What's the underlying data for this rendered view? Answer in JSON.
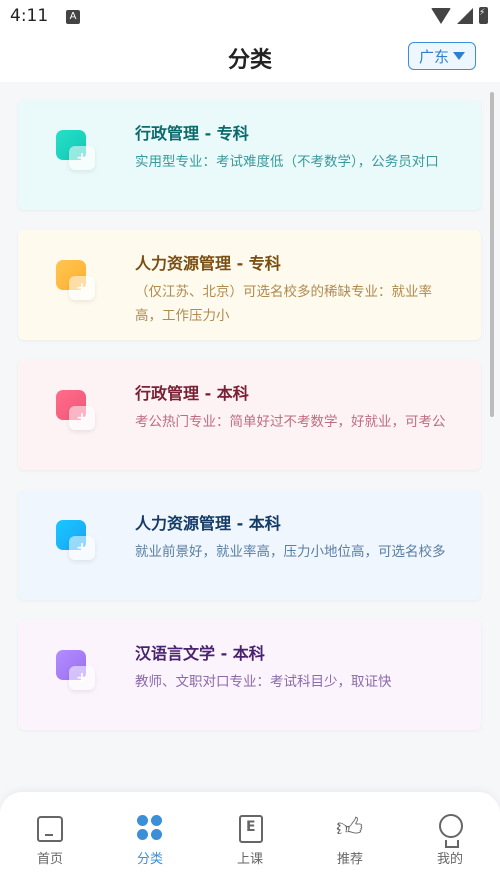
{
  "status": {
    "time": "4:11",
    "app_icon_glyph": "A"
  },
  "header": {
    "title": "分类",
    "region": "广东"
  },
  "cards": [
    {
      "title": "行政管理 - 专科",
      "desc": "实用型专业：考试难度低（不考数学），公务员对口",
      "icon": "add-course-icon"
    },
    {
      "title": "人力资源管理 - 专科",
      "desc": "（仅江苏、北京）可选名校多的稀缺专业：就业率高，工作压力小",
      "icon": "add-course-icon"
    },
    {
      "title": "行政管理 - 本科",
      "desc": "考公热门专业：简单好过不考数学，好就业，可考公",
      "icon": "add-course-icon"
    },
    {
      "title": "人力资源管理 - 本科",
      "desc": "就业前景好，就业率高，压力小地位高，可选名校多",
      "icon": "add-course-icon"
    },
    {
      "title": "汉语言文学 - 本科",
      "desc": "教师、文职对口专业：考试科目少，取证快",
      "icon": "add-course-icon"
    }
  ],
  "nav": [
    {
      "label": "首页",
      "icon": "home-icon"
    },
    {
      "label": "分类",
      "icon": "category-icon",
      "active": true
    },
    {
      "label": "上课",
      "icon": "lesson-icon"
    },
    {
      "label": "推荐",
      "icon": "thumbs-up-icon"
    },
    {
      "label": "我的",
      "icon": "profile-icon"
    }
  ],
  "colors": {
    "accent": "#3a8fd8",
    "background": "#f6f7f9"
  }
}
